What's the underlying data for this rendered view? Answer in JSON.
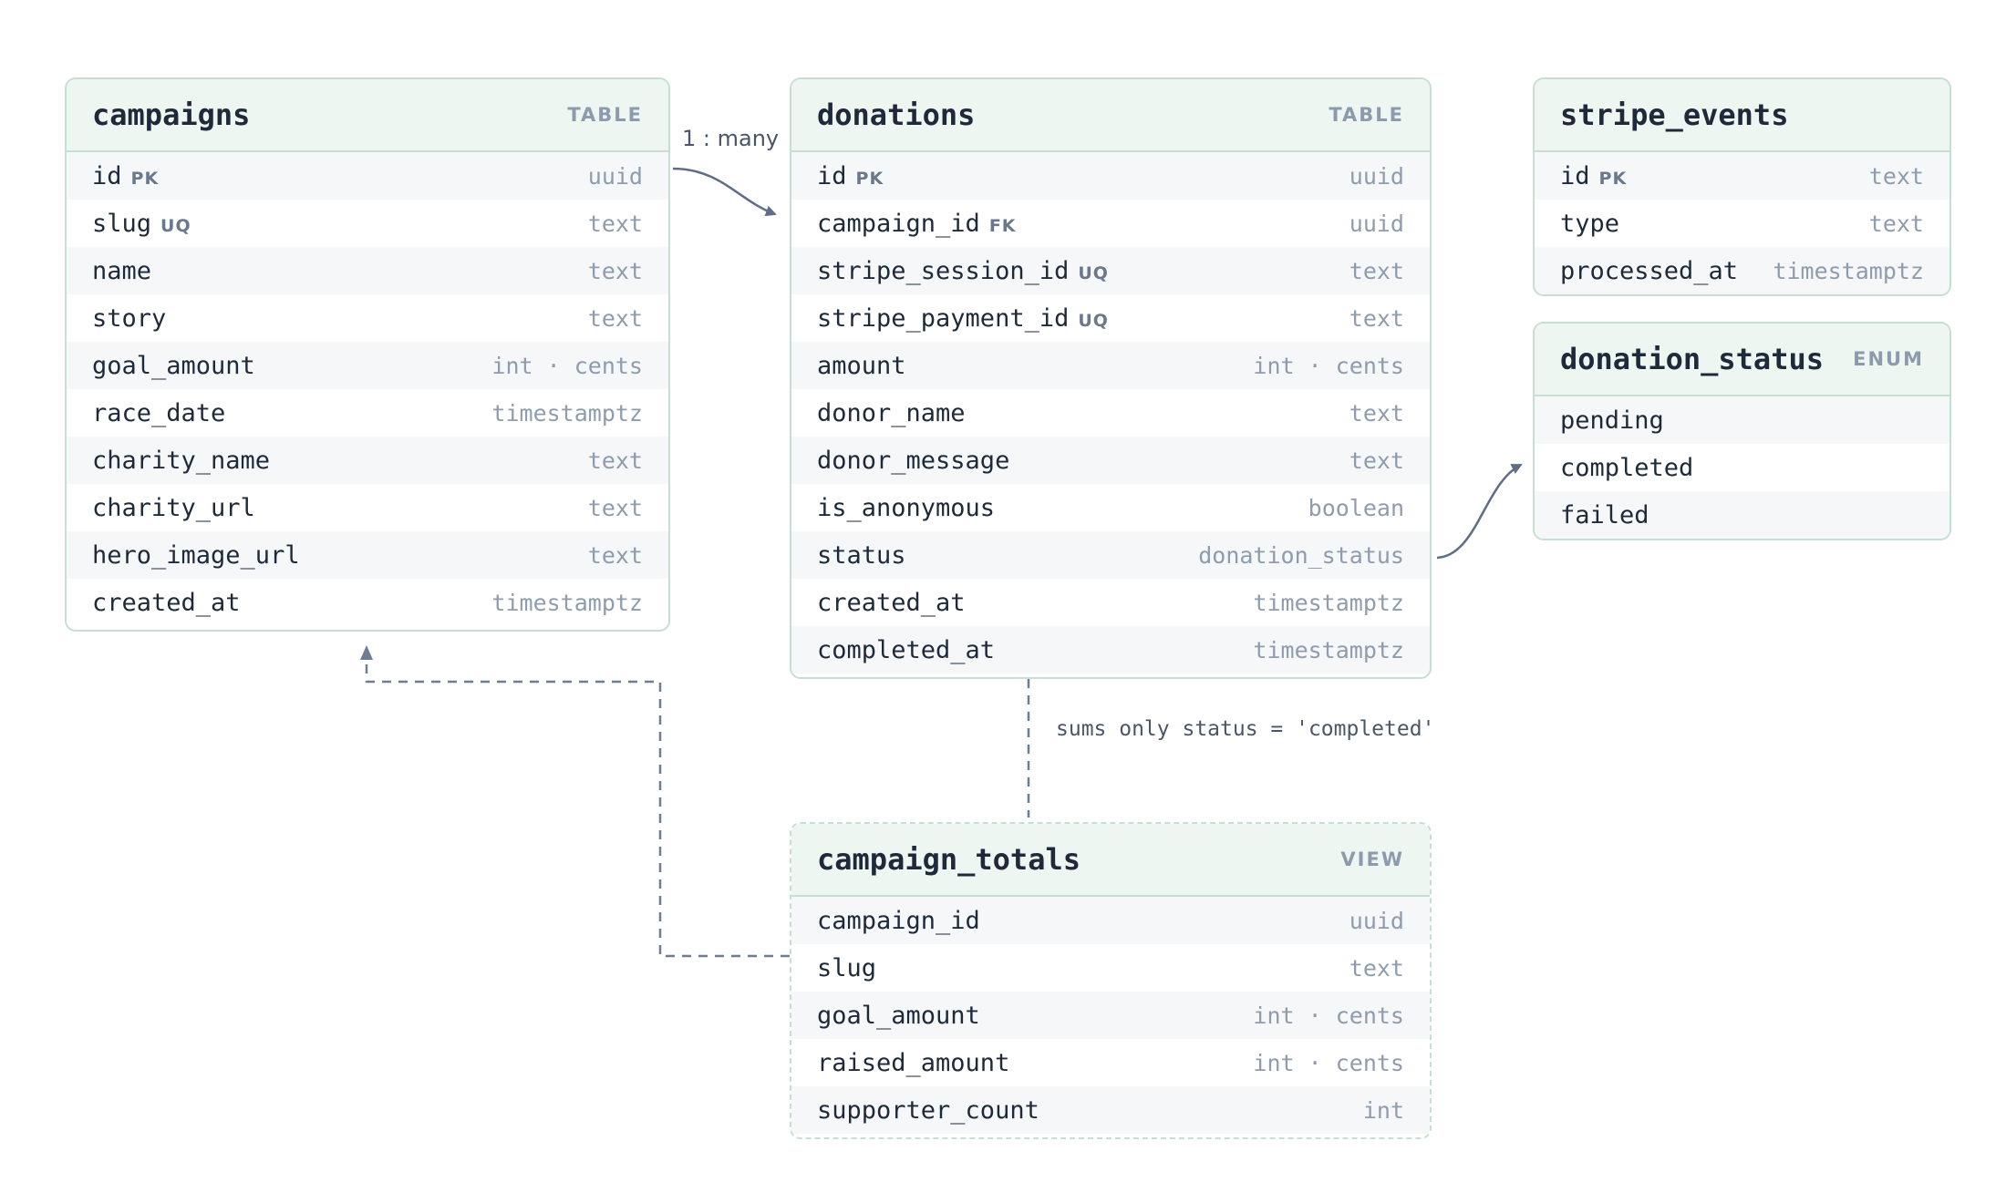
{
  "entities": {
    "campaigns": {
      "name": "campaigns",
      "kind": "TABLE",
      "columns": [
        {
          "name": "id",
          "badge": "PK",
          "type": "uuid"
        },
        {
          "name": "slug",
          "badge": "UQ",
          "type": "text"
        },
        {
          "name": "name",
          "badge": "",
          "type": "text"
        },
        {
          "name": "story",
          "badge": "",
          "type": "text"
        },
        {
          "name": "goal_amount",
          "badge": "",
          "type": "int · cents"
        },
        {
          "name": "race_date",
          "badge": "",
          "type": "timestamptz"
        },
        {
          "name": "charity_name",
          "badge": "",
          "type": "text"
        },
        {
          "name": "charity_url",
          "badge": "",
          "type": "text"
        },
        {
          "name": "hero_image_url",
          "badge": "",
          "type": "text"
        },
        {
          "name": "created_at",
          "badge": "",
          "type": "timestamptz"
        }
      ]
    },
    "donations": {
      "name": "donations",
      "kind": "TABLE",
      "columns": [
        {
          "name": "id",
          "badge": "PK",
          "type": "uuid"
        },
        {
          "name": "campaign_id",
          "badge": "FK",
          "type": "uuid"
        },
        {
          "name": "stripe_session_id",
          "badge": "UQ",
          "type": "text"
        },
        {
          "name": "stripe_payment_id",
          "badge": "UQ",
          "type": "text"
        },
        {
          "name": "amount",
          "badge": "",
          "type": "int · cents"
        },
        {
          "name": "donor_name",
          "badge": "",
          "type": "text"
        },
        {
          "name": "donor_message",
          "badge": "",
          "type": "text"
        },
        {
          "name": "is_anonymous",
          "badge": "",
          "type": "boolean"
        },
        {
          "name": "status",
          "badge": "",
          "type": "donation_status"
        },
        {
          "name": "created_at",
          "badge": "",
          "type": "timestamptz"
        },
        {
          "name": "completed_at",
          "badge": "",
          "type": "timestamptz"
        }
      ]
    },
    "stripe_events": {
      "name": "stripe_events",
      "kind": "",
      "columns": [
        {
          "name": "id",
          "badge": "PK",
          "type": "text"
        },
        {
          "name": "type",
          "badge": "",
          "type": "text"
        },
        {
          "name": "processed_at",
          "badge": "",
          "type": "timestamptz"
        }
      ]
    },
    "donation_status": {
      "name": "donation_status",
      "kind": "ENUM",
      "columns": [
        {
          "name": "pending",
          "badge": "",
          "type": ""
        },
        {
          "name": "completed",
          "badge": "",
          "type": ""
        },
        {
          "name": "failed",
          "badge": "",
          "type": ""
        }
      ]
    },
    "campaign_totals": {
      "name": "campaign_totals",
      "kind": "VIEW",
      "columns": [
        {
          "name": "campaign_id",
          "badge": "",
          "type": "uuid"
        },
        {
          "name": "slug",
          "badge": "",
          "type": "text"
        },
        {
          "name": "goal_amount",
          "badge": "",
          "type": "int · cents"
        },
        {
          "name": "raised_amount",
          "badge": "",
          "type": "int · cents"
        },
        {
          "name": "supporter_count",
          "badge": "",
          "type": "int"
        }
      ]
    }
  },
  "relations": {
    "campaigns_donations": "1 : many",
    "totals_filter": "sums only status = 'completed'"
  },
  "colors": {
    "border": "#c6dfd2",
    "header_bg": "#eef6f1",
    "edge": "#5f6e85"
  }
}
